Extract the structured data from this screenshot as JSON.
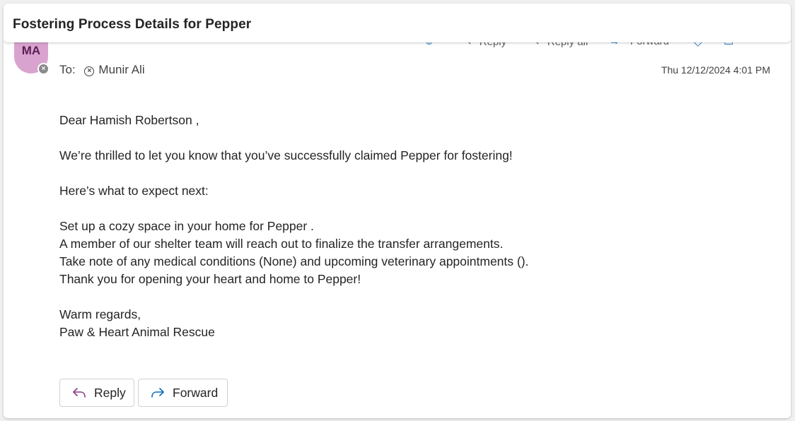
{
  "subject": "Fostering Process Details for Pepper",
  "toolbar": {
    "reply_label": "Reply",
    "reply_all_label": "Reply all",
    "forward_label": "Forward"
  },
  "sender": {
    "initials": "MA",
    "avatar_color": "#d9a3cf"
  },
  "recipients": {
    "to_label": "To:",
    "to_name": "Munir Ali"
  },
  "timestamp": "Thu 12/12/2024 4:01 PM",
  "body": {
    "greeting": "Dear Hamish Robertson ,",
    "intro": "We’re thrilled to let you know that you’ve successfully claimed Pepper for fostering!",
    "expect": "Here’s what to expect next:",
    "lines": [
      "Set up a cozy space in your home for Pepper .",
      "A member of our shelter team will reach out to finalize the transfer arrangements.",
      "Take note of any medical conditions (None) and upcoming veterinary appointments ().",
      "Thank you for opening your heart and home to Pepper!"
    ],
    "closing": "Warm regards,",
    "signature": "Paw & Heart Animal Rescue"
  },
  "actions": {
    "reply_label": "Reply",
    "forward_label": "Forward",
    "reply_icon_color": "#8b3a8b",
    "forward_icon_color": "#0f6cbd"
  }
}
